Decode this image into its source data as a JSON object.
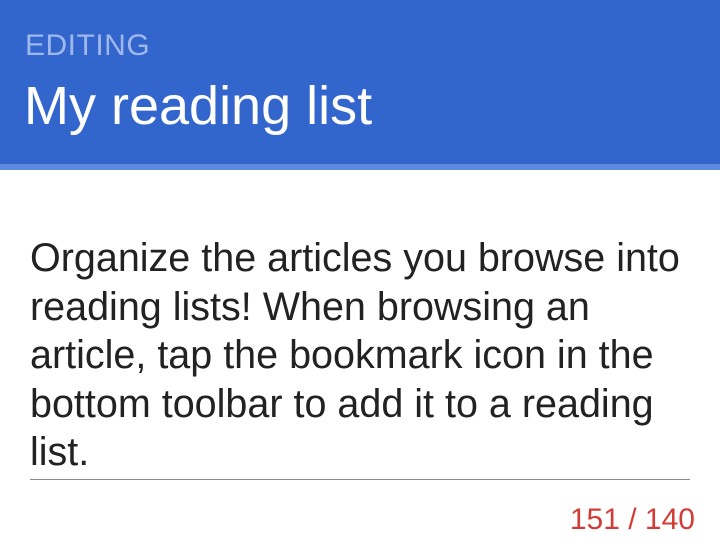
{
  "header": {
    "mode_label": "EDITING",
    "title": "My reading list"
  },
  "description": {
    "value": "Organize the articles you browse into reading lists! When browsing an article, tap the bookmark icon in the bottom toolbar to add it to a reading list."
  },
  "counter": {
    "text": "151 / 140"
  },
  "colors": {
    "header_background": "#3366cc",
    "mode_label": "#9fb8ec",
    "counter_error": "#d33c36"
  }
}
